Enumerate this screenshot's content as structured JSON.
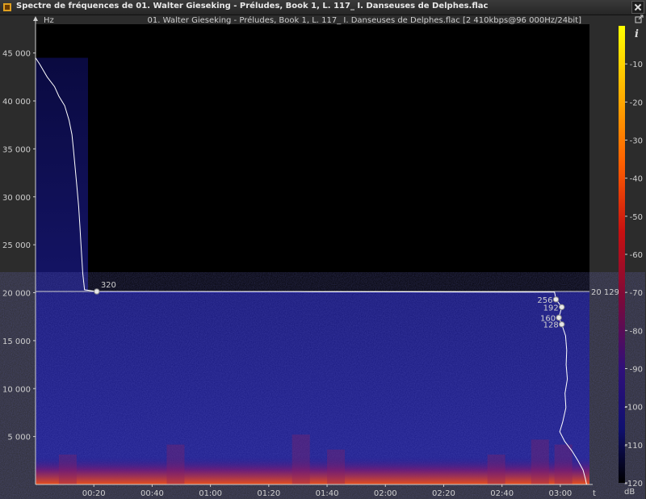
{
  "window": {
    "title": "Spectre de fréquences de 01. Walter Gieseking - Préludes, Book 1, L. 117_ I. Danseuses de Delphes.flac"
  },
  "header": {
    "file_info": "01. Walter Gieseking - Préludes, Book 1, L. 117_ I. Danseuses de Delphes.flac [2 410kbps@96 000Hz/24bit]"
  },
  "colors": {
    "background": "#000000",
    "spectrum_base": "#14147a",
    "spectrum_hot": "#e03a10",
    "curve": "#ffffff",
    "colorbar": [
      "#ffff00",
      "#ffb000",
      "#ff6000",
      "#c81010",
      "#7a0a3a",
      "#30107a",
      "#101070",
      "#000000"
    ]
  },
  "icons": {
    "info": "info-icon",
    "external": "external-link-icon",
    "close": "close-icon"
  },
  "chart_data": {
    "type": "heatmap",
    "xlabel": "t",
    "ylabel": "Hz",
    "y_ticks": [
      {
        "value": 5000,
        "label": "5 000"
      },
      {
        "value": 10000,
        "label": "10 000"
      },
      {
        "value": 15000,
        "label": "15 000"
      },
      {
        "value": 20000,
        "label": "20 000"
      },
      {
        "value": 25000,
        "label": "25 000"
      },
      {
        "value": 30000,
        "label": "30 000"
      },
      {
        "value": 35000,
        "label": "35 000"
      },
      {
        "value": 40000,
        "label": "40 000"
      },
      {
        "value": 45000,
        "label": "45 000"
      }
    ],
    "x_ticks": [
      {
        "value": 20,
        "label": "00:20"
      },
      {
        "value": 40,
        "label": "00:40"
      },
      {
        "value": 60,
        "label": "01:00"
      },
      {
        "value": 80,
        "label": "01:20"
      },
      {
        "value": 100,
        "label": "01:40"
      },
      {
        "value": 120,
        "label": "02:00"
      },
      {
        "value": 140,
        "label": "02:20"
      },
      {
        "value": 160,
        "label": "02:40"
      },
      {
        "value": 180,
        "label": "03:00"
      }
    ],
    "xlim": [
      0,
      190
    ],
    "ylim": [
      0,
      48000
    ],
    "cutoff_label": "20 129",
    "cutoff_value": 20129,
    "markers": [
      {
        "label": "320",
        "t": 21,
        "hz": 20129
      },
      {
        "label": "256",
        "t": 178.5,
        "hz": 19300
      },
      {
        "label": "192",
        "t": 180.5,
        "hz": 18500
      },
      {
        "label": "160",
        "t": 179.5,
        "hz": 17400
      },
      {
        "label": "128",
        "t": 180.5,
        "hz": 16700
      }
    ],
    "colorbar": {
      "unit": "dB",
      "ticks": [
        {
          "value": -10,
          "label": "-10"
        },
        {
          "value": -20,
          "label": "-20"
        },
        {
          "value": -30,
          "label": "-30"
        },
        {
          "value": -40,
          "label": "-40"
        },
        {
          "value": -50,
          "label": "-50"
        },
        {
          "value": -60,
          "label": "-60"
        },
        {
          "value": -70,
          "label": "-70"
        },
        {
          "value": -80,
          "label": "-80"
        },
        {
          "value": -90,
          "label": "-90"
        },
        {
          "value": -100,
          "label": "-100"
        },
        {
          "value": -110,
          "label": "-110"
        },
        {
          "value": -120,
          "label": "-120"
        }
      ],
      "range": [
        -120,
        0
      ]
    }
  }
}
